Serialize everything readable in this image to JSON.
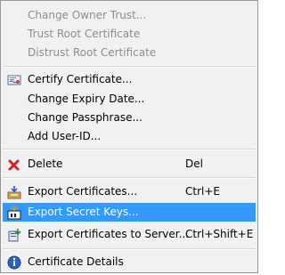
{
  "menu": {
    "items": [
      {
        "label": "Change Owner Trust...",
        "enabled": false
      },
      {
        "label": "Trust Root Certificate",
        "enabled": false
      },
      {
        "label": "Distrust Root Certificate",
        "enabled": false
      },
      {
        "label": "Certify Certificate...",
        "icon": "certify-icon",
        "enabled": true
      },
      {
        "label": "Change Expiry Date...",
        "enabled": true
      },
      {
        "label": "Change Passphrase...",
        "enabled": true
      },
      {
        "label": "Add User-ID...",
        "enabled": true
      },
      {
        "label": "Delete",
        "shortcut": "Del",
        "icon": "delete-icon",
        "enabled": true
      },
      {
        "label": "Export Certificates...",
        "shortcut": "Ctrl+E",
        "icon": "export-icon",
        "enabled": true
      },
      {
        "label": "Export Secret Keys...",
        "icon": "export-secret-keys-icon",
        "enabled": true,
        "highlighted": true
      },
      {
        "label": "Export Certificates to Server...",
        "shortcut": "Ctrl+Shift+E",
        "icon": "export-server-icon",
        "enabled": true
      },
      {
        "label": "Certificate Details",
        "icon": "info-icon",
        "enabled": true
      }
    ]
  }
}
